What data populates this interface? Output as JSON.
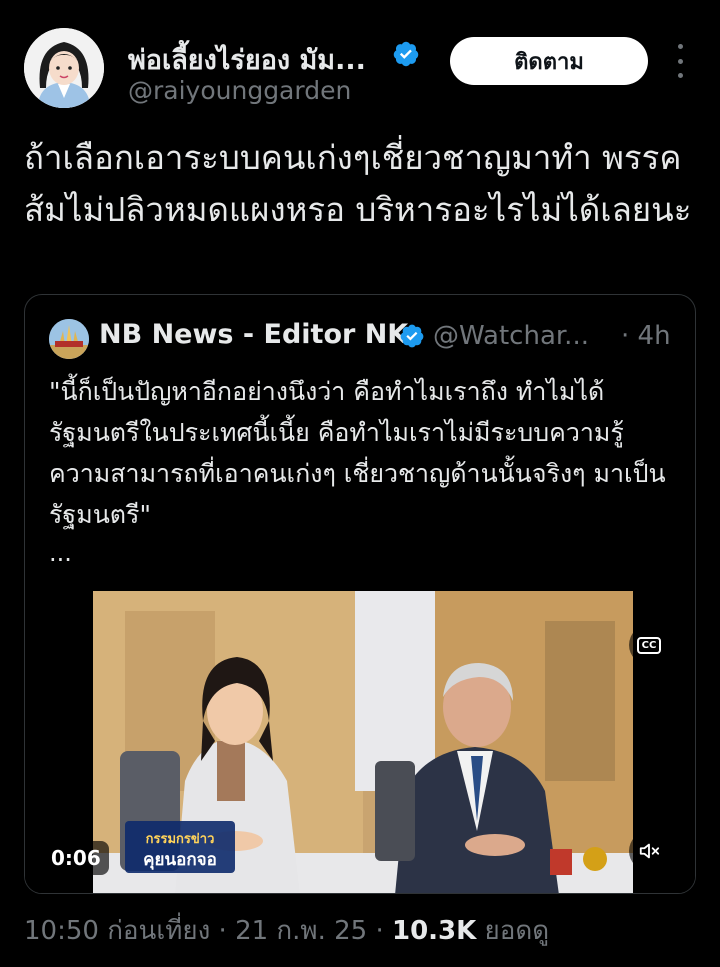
{
  "author": {
    "display_name": "พ่อเลี้ยงไร่ยอง มัม...",
    "handle": "@raiyounggarden",
    "follow_label": "ติดตาม"
  },
  "tweet": {
    "text": "ถ้าเลือกเอาระบบคนเก่งๆเชี่ยวชาญมาทำ พรรคส้มไม่ปลิวหมดแผงหรอ บริหารอะไรไม่ได้เลยนะ"
  },
  "quote": {
    "name": "NB News - Editor NK",
    "handle": "@Watchar...",
    "time": "· 4h",
    "text": "\"นี้ก็เป็นปัญหาอีกอย่างนึงว่า คือทำไมเราถึง ทำไมได้รัฐมนตรีในประเทศนี้เนี้ย คือทำไมเราไม่มีระบบความรู้ความสามารถที่เอาคนเก่งๆ เชี่ยวชาญด้านนั้นจริงๆ มาเป็นรัฐมนตรี\"",
    "ellipsis": "...",
    "video": {
      "duration": "0:06",
      "cc_label": "CC",
      "overlay_text_1": "กรรมกรข่าว",
      "overlay_text_2": "คุยนอกจอ"
    }
  },
  "meta": {
    "time": "10:50 ก่อนเที่ยง",
    "sep1": " · ",
    "date": "21 ก.พ. 25",
    "sep2": " · ",
    "views_count": "10.3K",
    "views_label": " ยอดดู"
  },
  "colors": {
    "background": "#000000",
    "verified": "#1d9bf0",
    "muted_text": "#71767b",
    "primary_text": "#e7e9ea"
  }
}
